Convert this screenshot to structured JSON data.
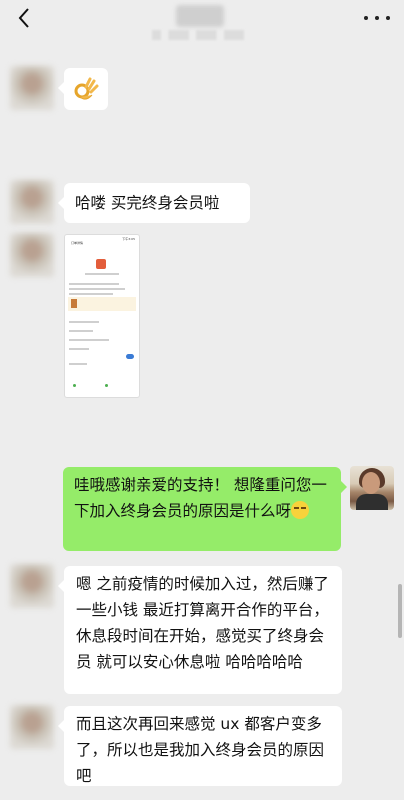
{
  "header": {
    "title": "",
    "subtitle": "",
    "back_icon": "chevron-left-icon",
    "more_icon": "more-dots-icon"
  },
  "messages": [
    {
      "side": "left",
      "type": "emoji",
      "icon": "ok-hand-icon"
    },
    {
      "side": "left",
      "type": "text",
      "text": "哈喽 买完终身会员啦"
    },
    {
      "side": "left",
      "type": "image",
      "caption": ""
    },
    {
      "side": "right",
      "type": "text",
      "text": "哇哦感谢亲爱的支持！ 想隆重问您一下加入终身会员的原因是什么呀",
      "trailing_icon": "shy-face-emoji-icon"
    },
    {
      "side": "left",
      "type": "text",
      "text": "嗯 之前疫情的时候加入过，然后赚了一些小钱 最近打算离开合作的平台，休息段时间在开始，感觉买了终身会员 就可以安心休息啦 哈哈哈哈哈"
    },
    {
      "side": "left",
      "type": "text",
      "text": "而且这次再回来感觉 ux 都客户变多了，所以也是我加入终身会员的原因吧"
    }
  ],
  "shared_image": {
    "time": "下午3:05",
    "title": "订单详情"
  },
  "colors": {
    "background": "#ededed",
    "bubble_self": "#95ec69",
    "bubble_other": "#ffffff"
  }
}
